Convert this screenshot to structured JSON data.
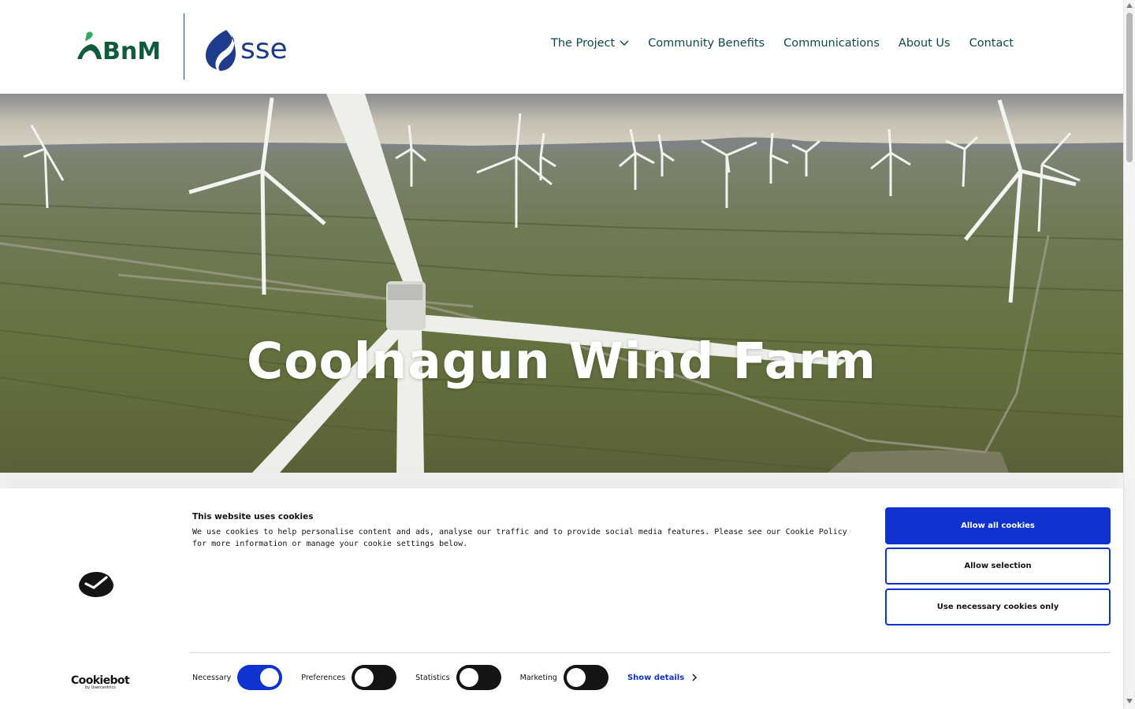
{
  "header": {
    "logos": {
      "left_text": "BnM",
      "right_text": "sse"
    },
    "nav": [
      {
        "label": "The Project",
        "has_dropdown": true
      },
      {
        "label": "Community Benefits"
      },
      {
        "label": "Communications"
      },
      {
        "label": "About Us"
      },
      {
        "label": "Contact"
      }
    ]
  },
  "hero": {
    "title": "Coolnagun Wind Farm"
  },
  "cookie_banner": {
    "title": "This website uses cookies",
    "text": "We use cookies to help personalise content and ads, analyse our traffic and to provide social media features. Please see our Cookie Policy for more information or manage your cookie settings below.",
    "buttons": {
      "allow_all": "Allow all cookies",
      "allow_selection": "Allow selection",
      "necessary_only": "Use necessary cookies only"
    },
    "toggles": [
      {
        "label": "Necessary",
        "on": true
      },
      {
        "label": "Preferences",
        "on": false
      },
      {
        "label": "Statistics",
        "on": false
      },
      {
        "label": "Marketing",
        "on": false
      }
    ],
    "show_details": "Show details",
    "brand": {
      "name": "Cookiebot",
      "sub": "by Usercentrics"
    }
  },
  "colors": {
    "nav_text": "#0e4a4a",
    "bnm_green": "#0f5b3a",
    "sse_blue": "#1f3b8c",
    "cookie_blue": "#1032cf"
  }
}
